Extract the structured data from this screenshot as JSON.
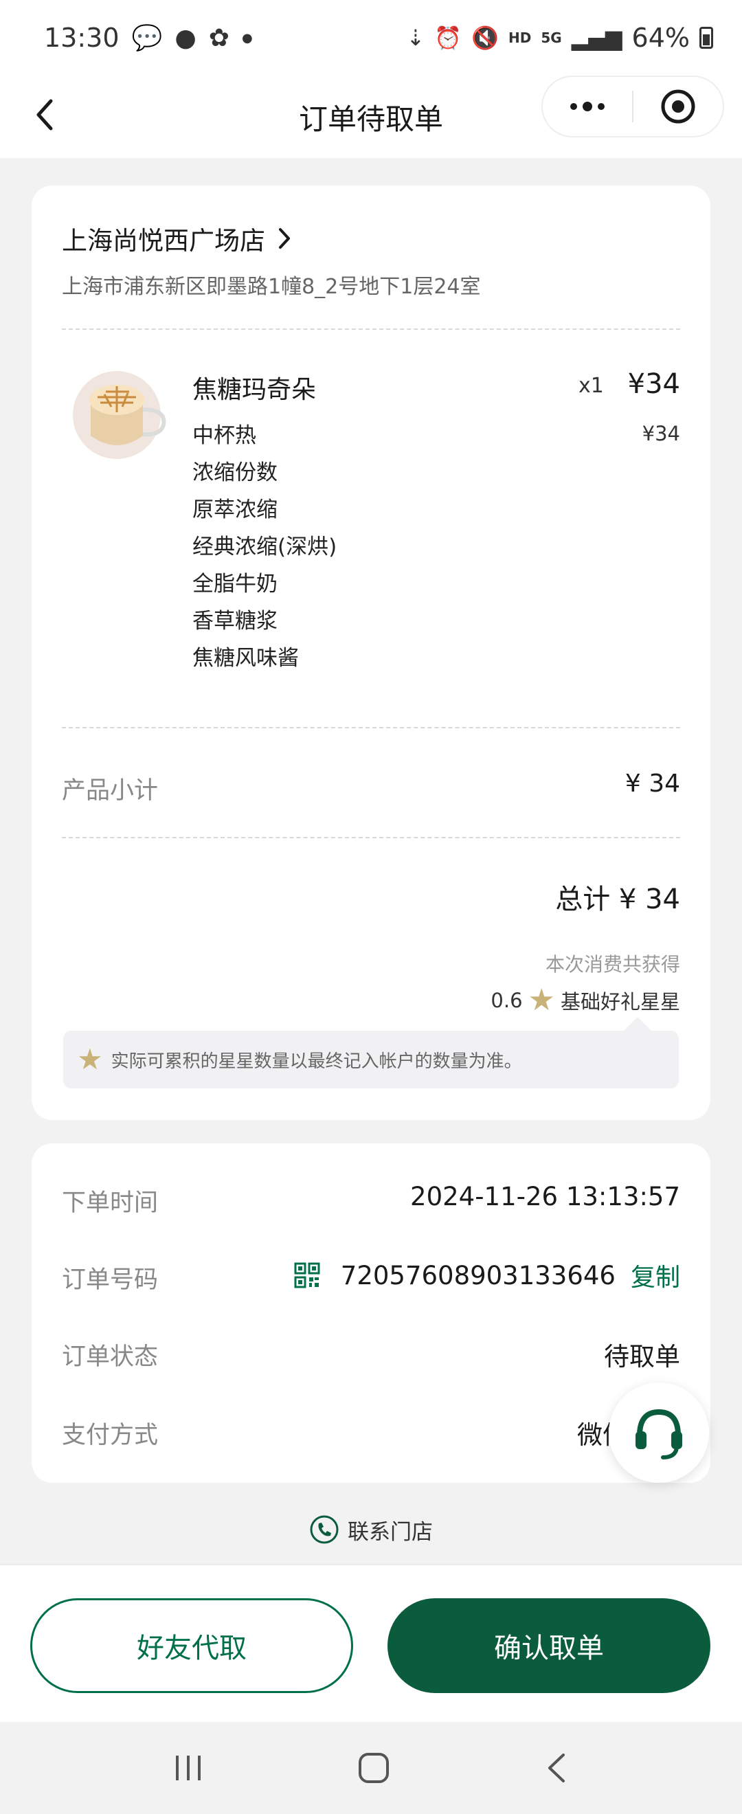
{
  "status_bar": {
    "time": "13:30",
    "battery": "64%",
    "hd_label": "HD",
    "net_label": "5G"
  },
  "nav": {
    "title": "订单待取单"
  },
  "store": {
    "name": "上海尚悦西广场店",
    "address": "上海市浦东新区即墨路1幢8_2号地下1层24室"
  },
  "product": {
    "name": "焦糖玛奇朵",
    "quantity": "x1",
    "price": "¥34",
    "size_price": "¥34",
    "options": [
      "中杯热",
      "浓缩份数",
      "原萃浓缩",
      "经典浓缩(深烘)",
      "全脂牛奶",
      "香草糖浆",
      "焦糖风味酱"
    ]
  },
  "summary": {
    "subtotal_label": "产品小计",
    "subtotal_value": "¥ 34",
    "total": "总计 ¥ 34",
    "earn_text": "本次消费共获得",
    "stars_count": "0.6",
    "stars_label": "基础好礼星星",
    "note": "实际可累积的星星数量以最终记入帐户的数量为准。"
  },
  "info": {
    "order_time_label": "下单时间",
    "order_time_value": "2024-11-26 13:13:57",
    "order_no_label": "订单号码",
    "order_no_value": "72057608903133646",
    "copy_label": "复制",
    "status_label": "订单状态",
    "status_value": "待取单",
    "payment_label": "支付方式",
    "payment_value": "微信"
  },
  "contact_label": "联系门店",
  "buttons": {
    "friend": "好友代取",
    "confirm": "确认取单"
  },
  "colors": {
    "brand_green": "#00704a",
    "dark_green": "#0b5c3d",
    "star_gold": "#c9b278"
  }
}
